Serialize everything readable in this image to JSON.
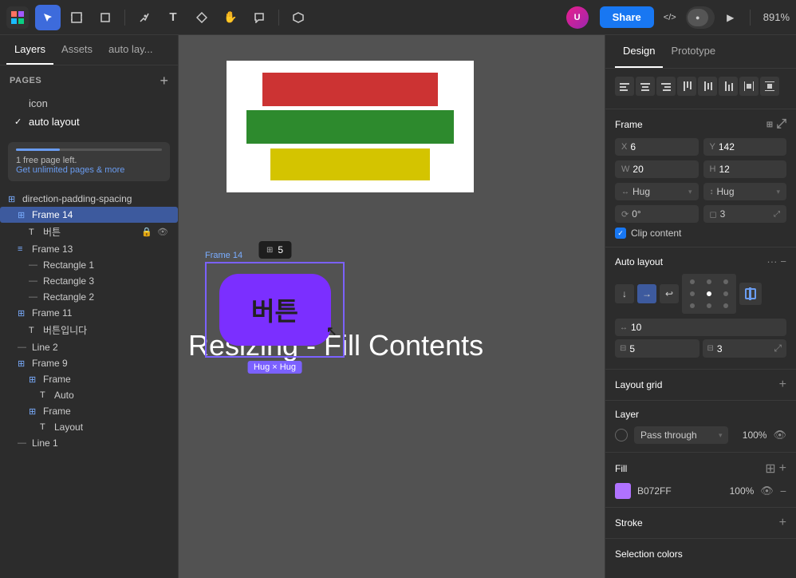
{
  "toolbar": {
    "logo_icon": "F",
    "tools": [
      {
        "name": "move-tool",
        "label": "V",
        "active": true
      },
      {
        "name": "frame-tool",
        "label": "⊞",
        "active": false
      },
      {
        "name": "shape-tool",
        "label": "□",
        "active": false
      },
      {
        "name": "pen-tool",
        "label": "✒",
        "active": false
      },
      {
        "name": "text-tool",
        "label": "T",
        "active": false
      },
      {
        "name": "component-tool",
        "label": "⊕",
        "active": false
      },
      {
        "name": "hand-tool",
        "label": "✋",
        "active": false
      },
      {
        "name": "comment-tool",
        "label": "💬",
        "active": false
      }
    ],
    "share_label": "Share",
    "zoom_label": "891%",
    "play_icon": "▶",
    "code_icon": "</>",
    "plugins_icon": "⚡"
  },
  "sidebar": {
    "tabs": [
      {
        "name": "tab-layers",
        "label": "Layers",
        "active": true
      },
      {
        "name": "tab-assets",
        "label": "Assets",
        "active": false
      },
      {
        "name": "tab-auto-layout",
        "label": "auto lay...",
        "active": false
      }
    ],
    "pages_title": "Pages",
    "pages_add_icon": "+",
    "pages": [
      {
        "name": "icon",
        "label": "icon",
        "active": false
      },
      {
        "name": "auto-layout",
        "label": "auto layout",
        "active": true
      }
    ],
    "banner": {
      "text": "1 free page left.",
      "link_text": "Get unlimited pages & more"
    },
    "layers": [
      {
        "id": "direction-padding-spacing",
        "label": "direction-padding-spacing",
        "indent": 0,
        "icon": "frame",
        "active": false
      },
      {
        "id": "frame-14",
        "label": "Frame 14",
        "indent": 1,
        "icon": "frame",
        "active": true
      },
      {
        "id": "button",
        "label": "버튼",
        "indent": 2,
        "icon": "text",
        "active": false,
        "has_actions": true
      },
      {
        "id": "frame-13",
        "label": "Frame 13",
        "indent": 1,
        "icon": "frame",
        "active": false
      },
      {
        "id": "rectangle-1",
        "label": "Rectangle 1",
        "indent": 2,
        "icon": "rect",
        "active": false
      },
      {
        "id": "rectangle-3",
        "label": "Rectangle 3",
        "indent": 2,
        "icon": "rect",
        "active": false
      },
      {
        "id": "rectangle-2",
        "label": "Rectangle 2",
        "indent": 2,
        "icon": "rect",
        "active": false
      },
      {
        "id": "frame-11",
        "label": "Frame 11",
        "indent": 1,
        "icon": "frame",
        "active": false
      },
      {
        "id": "button-text",
        "label": "버튼입니다",
        "indent": 2,
        "icon": "text",
        "active": false
      },
      {
        "id": "line-2",
        "label": "Line 2",
        "indent": 1,
        "icon": "line",
        "active": false
      },
      {
        "id": "frame-9",
        "label": "Frame 9",
        "indent": 1,
        "icon": "frame",
        "active": false
      },
      {
        "id": "frame-inner",
        "label": "Frame",
        "indent": 2,
        "icon": "frame",
        "active": false
      },
      {
        "id": "auto-text",
        "label": "Auto",
        "indent": 3,
        "icon": "text",
        "active": false
      },
      {
        "id": "frame-inner2",
        "label": "Frame",
        "indent": 2,
        "icon": "frame",
        "active": false
      },
      {
        "id": "layout-text",
        "label": "Layout",
        "indent": 3,
        "icon": "text",
        "active": false
      },
      {
        "id": "line-1",
        "label": "Line 1",
        "indent": 1,
        "icon": "line",
        "active": false
      }
    ]
  },
  "canvas": {
    "frame_box_label": "Frame 14",
    "canvas_title": "Resizing - Fill Contents",
    "button_text": "버튼",
    "hug_label": "Hug × Hug",
    "size_tooltip": "5",
    "size_tooltip_icon": "⊞"
  },
  "right_panel": {
    "tabs": [
      {
        "name": "tab-design",
        "label": "Design",
        "active": true
      },
      {
        "name": "tab-prototype",
        "label": "Prototype",
        "active": false
      }
    ],
    "frame_section": {
      "title": "Frame",
      "x": {
        "label": "X",
        "value": "6"
      },
      "y": {
        "label": "Y",
        "value": "142"
      },
      "w": {
        "label": "W",
        "value": "20"
      },
      "h": {
        "label": "H",
        "value": "12"
      },
      "hug_x": {
        "label": "Hug",
        "value": "Hug"
      },
      "hug_y": {
        "label": "Hug",
        "value": "Hug"
      },
      "rotation": {
        "label": "⟳",
        "value": "0°"
      },
      "corner": {
        "label": "◻",
        "value": "3"
      },
      "clip_content": "Clip content"
    },
    "auto_layout": {
      "title": "Auto layout",
      "gap": "10",
      "padding_h": "5",
      "padding_v": "3"
    },
    "layout_grid": {
      "title": "Layout grid"
    },
    "layer": {
      "title": "Layer",
      "blend_mode": "Pass through",
      "opacity": "100%"
    },
    "fill": {
      "title": "Fill",
      "color": "B072FF",
      "opacity": "100%"
    },
    "stroke": {
      "title": "Stroke"
    },
    "selection_colors": {
      "title": "Selection colors"
    },
    "alignment_icons": [
      "⬛",
      "⬛",
      "⬛",
      "⬛",
      "⬛",
      "⬛",
      "⬛",
      "⬛"
    ]
  }
}
